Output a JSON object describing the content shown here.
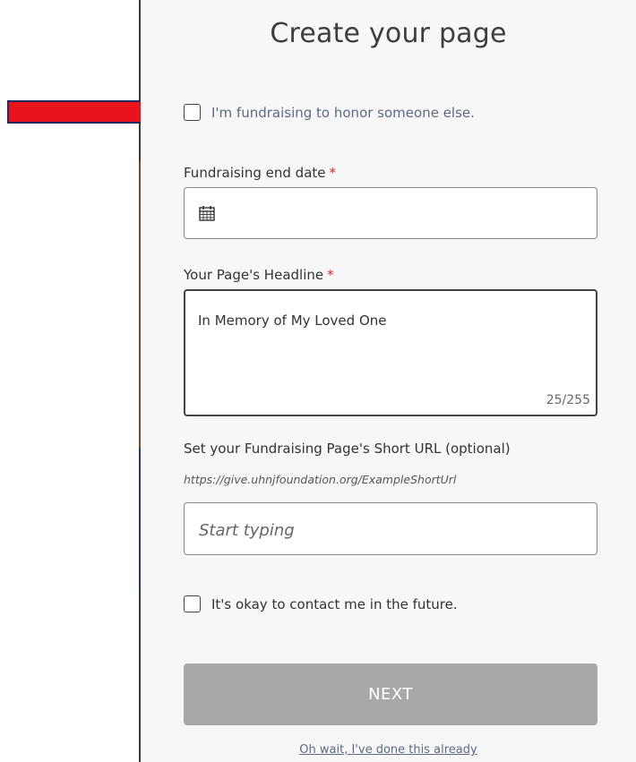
{
  "page": {
    "title": "Create your page"
  },
  "honor_option": {
    "label": "I'm fundraising to honor someone else.",
    "checked": false,
    "arrow_color": "#e8141c"
  },
  "end_date": {
    "label": "Fundraising end date",
    "required_mark": "*",
    "value": "",
    "icon": "calendar-icon"
  },
  "headline": {
    "label": "Your Page's Headline",
    "required_mark": "*",
    "value": "In Memory of My Loved One",
    "counter": "25/255"
  },
  "short_url": {
    "label": "Set your Fundraising Page's Short URL (optional)",
    "example_url": "https://give.uhnjfoundation.org/ExampleShortUrl",
    "placeholder": "Start typing",
    "value": ""
  },
  "contact_option": {
    "label": "It's okay to contact me in the future.",
    "checked": false
  },
  "actions": {
    "next_label": "NEXT",
    "done_link": "Oh wait, I've done this already"
  },
  "colors": {
    "required": "#d12c2c",
    "button_disabled": "#a8a8a8",
    "link": "#5b6a85"
  }
}
